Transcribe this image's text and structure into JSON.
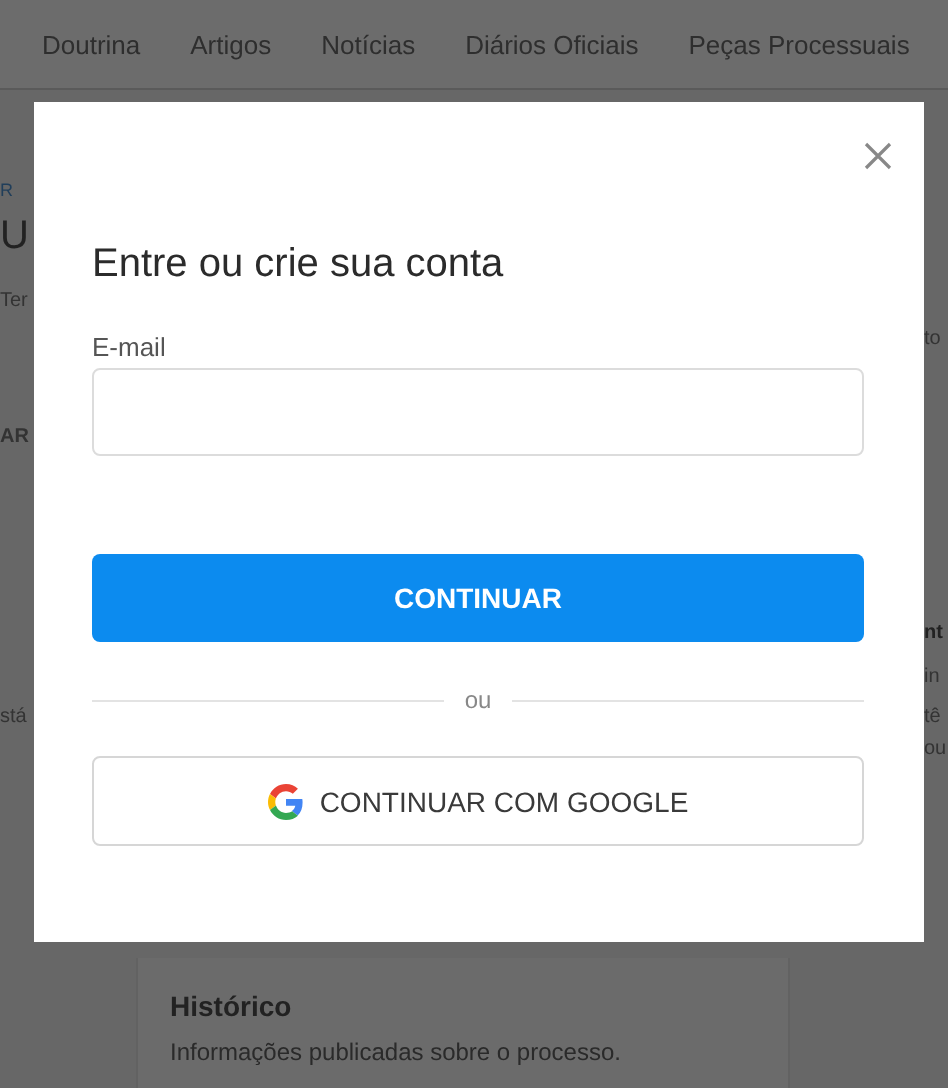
{
  "nav": {
    "items": [
      "Doutrina",
      "Artigos",
      "Notícias",
      "Diários Oficiais",
      "Peças Processuais"
    ]
  },
  "left_fragments": [
    {
      "text": "R",
      "kind": "link"
    },
    {
      "text": "U",
      "kind": "heading"
    },
    {
      "text": "Ter",
      "kind": "text"
    },
    {
      "text": "AR",
      "kind": "button"
    },
    {
      "text": "stá",
      "kind": "text"
    }
  ],
  "right_fragments": [
    {
      "text": "to",
      "kind": "text"
    },
    {
      "text": "nt",
      "kind": "heading"
    },
    {
      "text": "in",
      "kind": "text"
    },
    {
      "text": "tê",
      "kind": "text"
    },
    {
      "text": "ou",
      "kind": "text"
    }
  ],
  "card": {
    "title": "Histórico",
    "description": "Informações publicadas sobre o processo."
  },
  "modal": {
    "title": "Entre ou crie sua conta",
    "email_label": "E-mail",
    "continue_button": "CONTINUAR",
    "divider": "ou",
    "google_button": "CONTINUAR COM GOOGLE"
  }
}
